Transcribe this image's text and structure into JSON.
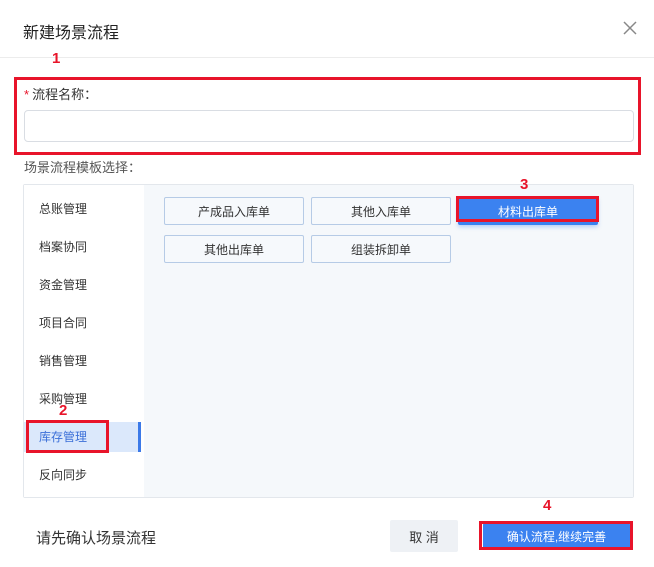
{
  "dialog": {
    "title": "新建场景流程",
    "close_icon": "close-icon"
  },
  "form": {
    "name_label": "流程名称：",
    "required_mark": "*",
    "name_value": "",
    "template_label": "场景流程模板选择："
  },
  "sidebar": {
    "items": [
      {
        "label": "总账管理"
      },
      {
        "label": "档案协同"
      },
      {
        "label": "资金管理"
      },
      {
        "label": "项目合同"
      },
      {
        "label": "销售管理"
      },
      {
        "label": "采购管理"
      },
      {
        "label": "库存管理",
        "active": true
      },
      {
        "label": "反向同步"
      }
    ]
  },
  "templates": [
    {
      "label": "产成品入库单"
    },
    {
      "label": "其他入库单"
    },
    {
      "label": "材料出库单",
      "selected": true
    },
    {
      "label": "其他出库单"
    },
    {
      "label": "组装拆卸单"
    }
  ],
  "footer": {
    "hint": "请先确认场景流程",
    "cancel_label": "取 消",
    "confirm_label": "确认流程,继续完善"
  },
  "annotations": {
    "n1": "1",
    "n2": "2",
    "n3": "3",
    "n4": "4"
  },
  "colors": {
    "accent": "#3b82f0",
    "annotation": "#e8142a",
    "active_bg": "#dbe8fb"
  }
}
